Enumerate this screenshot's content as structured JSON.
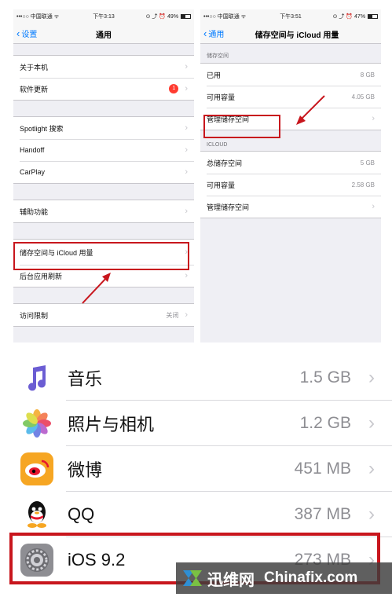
{
  "left_phone": {
    "status": {
      "carrier": "•••○○ 中国联通 ᯤ",
      "time": "下午3:13",
      "icons": "⊙ ⤴ ⏰",
      "battery_percent": "49%",
      "battery_level": 0.49
    },
    "nav": {
      "back_label": "设置",
      "title": "通用"
    },
    "groups": [
      [
        {
          "label": "关于本机",
          "value": ""
        },
        {
          "label": "软件更新",
          "value": "",
          "badge": "1"
        }
      ],
      [
        {
          "label": "Spotlight 搜索",
          "value": ""
        },
        {
          "label": "Handoff",
          "value": ""
        },
        {
          "label": "CarPlay",
          "value": ""
        }
      ],
      [
        {
          "label": "辅助功能",
          "value": ""
        }
      ],
      [
        {
          "label": "储存空间与 iCloud 用量",
          "value": ""
        },
        {
          "label": "后台应用刷新",
          "value": ""
        }
      ],
      [
        {
          "label": "访问限制",
          "value": "关闭"
        }
      ]
    ]
  },
  "right_phone": {
    "status": {
      "carrier": "•••○○ 中国联通 ᯤ",
      "time": "下午3:51",
      "icons": "⊙ ⤴ ⏰",
      "battery_percent": "47%",
      "battery_level": 0.47
    },
    "nav": {
      "back_label": "通用",
      "title": "储存空间与 iCloud 用量"
    },
    "storage_header": "储存空间",
    "storage_rows": [
      {
        "label": "已用",
        "value": "8 GB"
      },
      {
        "label": "可用容量",
        "value": "4.05 GB"
      },
      {
        "label": "管理储存空间",
        "value": ""
      }
    ],
    "icloud_header": "ICLOUD",
    "icloud_rows": [
      {
        "label": "总储存空间",
        "value": "5 GB"
      },
      {
        "label": "可用容量",
        "value": "2.58 GB"
      },
      {
        "label": "管理储存空间",
        "value": ""
      }
    ]
  },
  "apps": [
    {
      "name": "音乐",
      "size": "1.5 GB",
      "icon": "music-icon"
    },
    {
      "name": "照片与相机",
      "size": "1.2 GB",
      "icon": "photos-icon"
    },
    {
      "name": "微博",
      "size": "451 MB",
      "icon": "weibo-icon"
    },
    {
      "name": "QQ",
      "size": "387 MB",
      "icon": "qq-icon"
    },
    {
      "name": "iOS 9.2",
      "size": "273 MB",
      "icon": "settings-gear-icon"
    }
  ],
  "watermark": {
    "brand": "迅维网",
    "site": "Chinafix.com"
  },
  "colors": {
    "ios_blue": "#007aff",
    "highlight_red": "#c8161d",
    "badge_red": "#ff3b30"
  }
}
